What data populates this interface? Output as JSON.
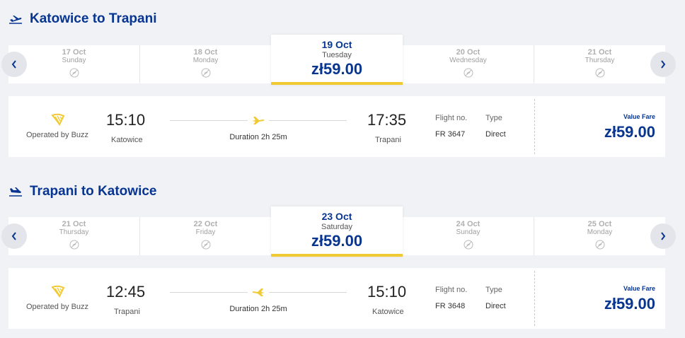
{
  "outbound": {
    "title": "Katowice to Trapani",
    "dates": [
      {
        "date": "17 Oct",
        "weekday": "Sunday"
      },
      {
        "date": "18 Oct",
        "weekday": "Monday"
      },
      {
        "date": "19 Oct",
        "weekday": "Tuesday",
        "price": "zł59.00",
        "selected": true
      },
      {
        "date": "20 Oct",
        "weekday": "Wednesday"
      },
      {
        "date": "21 Oct",
        "weekday": "Thursday"
      }
    ],
    "flight": {
      "operated_by": "Operated by Buzz",
      "depart_time": "15:10",
      "depart_city": "Katowice",
      "duration": "Duration 2h 25m",
      "arrive_time": "17:35",
      "arrive_city": "Trapani",
      "flight_no_label": "Flight no.",
      "flight_no": "FR 3647",
      "type_label": "Type",
      "type": "Direct",
      "fare_label": "Value Fare",
      "fare_price": "zł59.00"
    }
  },
  "return": {
    "title": "Trapani to Katowice",
    "dates": [
      {
        "date": "21 Oct",
        "weekday": "Thursday"
      },
      {
        "date": "22 Oct",
        "weekday": "Friday"
      },
      {
        "date": "23 Oct",
        "weekday": "Saturday",
        "price": "zł59.00",
        "selected": true
      },
      {
        "date": "24 Oct",
        "weekday": "Sunday"
      },
      {
        "date": "25 Oct",
        "weekday": "Monday"
      }
    ],
    "flight": {
      "operated_by": "Operated by Buzz",
      "depart_time": "12:45",
      "depart_city": "Trapani",
      "duration": "Duration 2h 25m",
      "arrive_time": "15:10",
      "arrive_city": "Katowice",
      "flight_no_label": "Flight no.",
      "flight_no": "FR 3648",
      "type_label": "Type",
      "type": "Direct",
      "fare_label": "Value Fare",
      "fare_price": "zł59.00"
    }
  },
  "colors": {
    "brand_blue": "#073590",
    "brand_yellow": "#f1c933"
  }
}
